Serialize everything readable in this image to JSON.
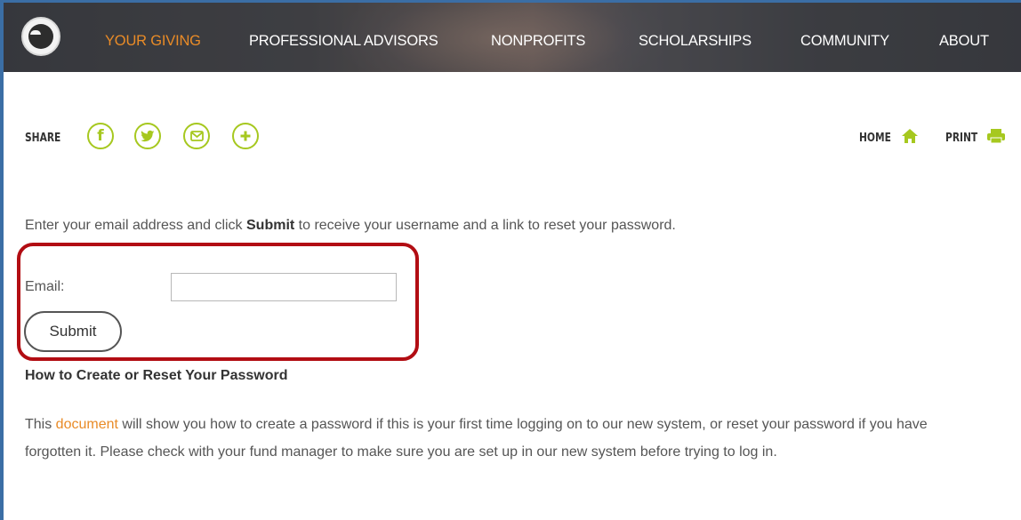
{
  "nav": {
    "items": [
      {
        "label": "YOUR GIVING",
        "active": true
      },
      {
        "label": "PROFESSIONAL ADVISORS",
        "active": false
      },
      {
        "label": "NONPROFITS",
        "active": false
      },
      {
        "label": "SCHOLARSHIPS",
        "active": false
      },
      {
        "label": "COMMUNITY",
        "active": false
      },
      {
        "label": "ABOUT",
        "active": false
      }
    ]
  },
  "share": {
    "label": "SHARE",
    "icons": [
      "facebook-icon",
      "twitter-icon",
      "email-icon",
      "plus-icon"
    ]
  },
  "utility": {
    "home_label": "HOME",
    "print_label": "PRINT"
  },
  "form": {
    "intro_before": "Enter your email address and click ",
    "intro_bold": "Submit",
    "intro_after": " to receive your username and a link to reset your password.",
    "email_label": "Email:",
    "email_value": "",
    "submit_label": "Submit"
  },
  "help": {
    "title": "How to Create or Reset Your Password",
    "text_before": "This ",
    "link_text": "document",
    "text_after": " will show you how to create a password if this is your first time logging on to our new system, or reset your password if you have forgotten it. Please check with your fund manager to make sure you are set up in our new system before trying to log in."
  },
  "colors": {
    "accent_orange": "#e98b27",
    "accent_green": "#a6c81f",
    "highlight_red": "#b20d13"
  }
}
